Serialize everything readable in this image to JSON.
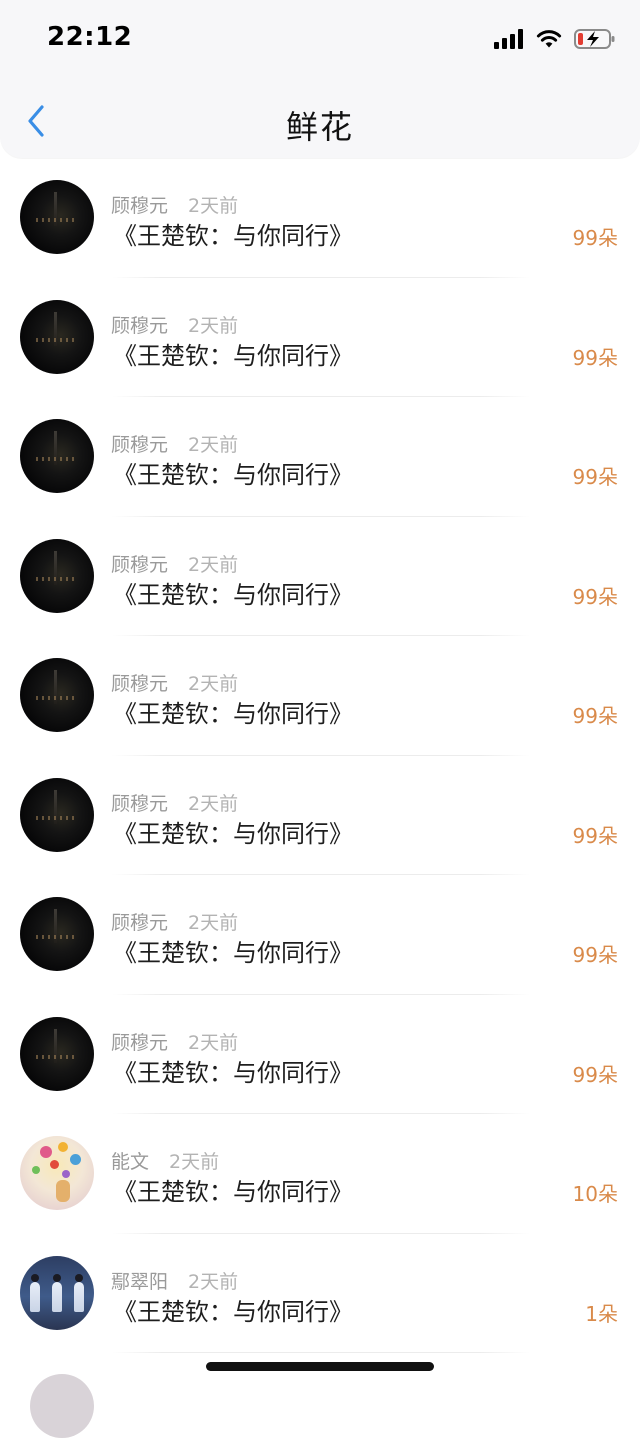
{
  "status_bar": {
    "time": "22:12",
    "icons": [
      "signal-icon",
      "wifi-icon",
      "battery-charging-icon"
    ]
  },
  "header": {
    "title": "鲜花",
    "back_icon": "chevron-left-icon"
  },
  "colors": {
    "accent_blue": "#3a8ee6",
    "amount_orange": "#d98a4a",
    "meta_gray": "#9a9a9a"
  },
  "items": [
    {
      "name": "顾穆元",
      "time": "2天前",
      "work": "《王楚钦：与你同行》",
      "amount": "99朵",
      "avatar": "dark-night-avatar"
    },
    {
      "name": "顾穆元",
      "time": "2天前",
      "work": "《王楚钦：与你同行》",
      "amount": "99朵",
      "avatar": "dark-night-avatar"
    },
    {
      "name": "顾穆元",
      "time": "2天前",
      "work": "《王楚钦：与你同行》",
      "amount": "99朵",
      "avatar": "dark-night-avatar"
    },
    {
      "name": "顾穆元",
      "time": "2天前",
      "work": "《王楚钦：与你同行》",
      "amount": "99朵",
      "avatar": "dark-night-avatar"
    },
    {
      "name": "顾穆元",
      "time": "2天前",
      "work": "《王楚钦：与你同行》",
      "amount": "99朵",
      "avatar": "dark-night-avatar"
    },
    {
      "name": "顾穆元",
      "time": "2天前",
      "work": "《王楚钦：与你同行》",
      "amount": "99朵",
      "avatar": "dark-night-avatar"
    },
    {
      "name": "顾穆元",
      "time": "2天前",
      "work": "《王楚钦：与你同行》",
      "amount": "99朵",
      "avatar": "dark-night-avatar"
    },
    {
      "name": "顾穆元",
      "time": "2天前",
      "work": "《王楚钦：与你同行》",
      "amount": "99朵",
      "avatar": "dark-night-avatar"
    },
    {
      "name": "能文",
      "time": "2天前",
      "work": "《王楚钦：与你同行》",
      "amount": "10朵",
      "avatar": "colorful-avatar"
    },
    {
      "name": "鄢翠阳",
      "time": "2天前",
      "work": "《王楚钦：与你同行》",
      "amount": "1朵",
      "avatar": "stage-avatar"
    }
  ]
}
